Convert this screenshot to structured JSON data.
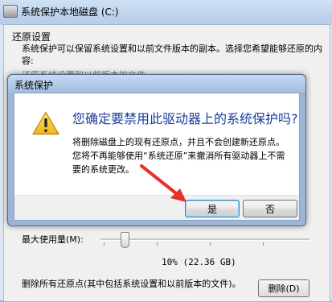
{
  "parent_window": {
    "title": "系统保护本地磁盘 (C:)",
    "group_title": "还原设置",
    "description": "系统保护可以保留系统设置和以前文件版本的副本。选择您希望能够还原的内容:",
    "radio_partial": "还原系统设置和以前版本的文件",
    "max_usage_label": "最大使用量(M):",
    "usage_value": "10% (22.36 GB)",
    "delete_description": "删除所有还原点(其中包括系统设置和以前版本的文件)。",
    "delete_button": "删除(D)"
  },
  "dialog": {
    "title": "系统保护",
    "question": "您确定要禁用此驱动器上的系统保护吗?",
    "body": "将删除磁盘上的现有还原点，并且不会创建新还原点。您将不再能够使用“系统还原”来撤消所有驱动器上不需要的系统更改。",
    "yes_button": "是",
    "no_button": "否"
  },
  "colors": {
    "question_text": "#1a3e99",
    "arrow": "#e8302a",
    "warning_fill": "#f3c623"
  },
  "icons": {
    "dialog_icon": "warning-icon",
    "annotation": "red-arrow-annotation"
  }
}
